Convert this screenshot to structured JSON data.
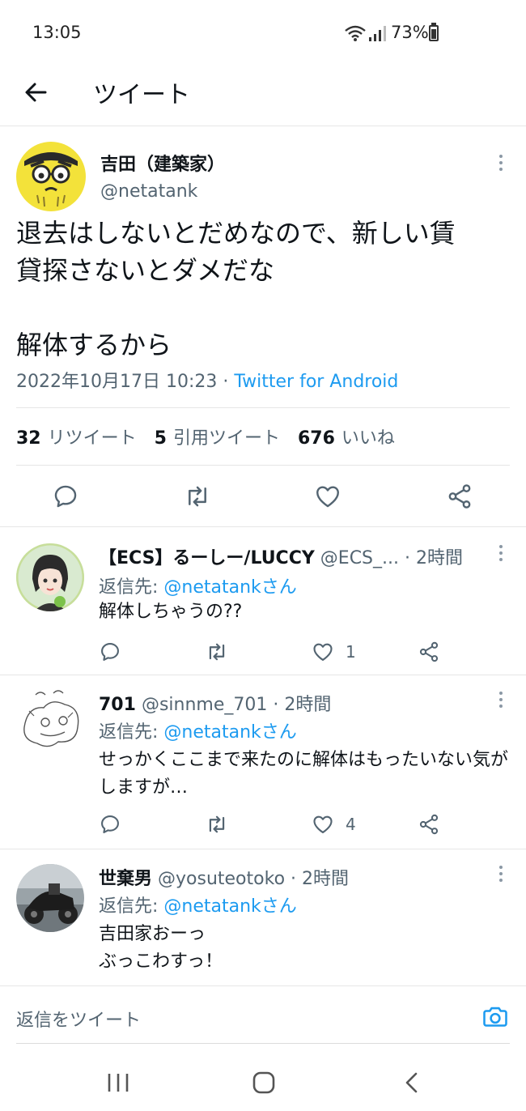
{
  "status_bar": {
    "time": "13:05",
    "battery": "73%"
  },
  "header": {
    "title": "ツイート"
  },
  "tweet": {
    "display_name": "吉田（建築家）",
    "handle": "@netatank",
    "text_lines": [
      "退去はしないとだめなので、新しい賃",
      "貸探さないとダメだな",
      "",
      "解体するから"
    ],
    "date": "2022年10月17日 10:23 · ",
    "source": "Twitter for Android",
    "stats": {
      "retweets": "32",
      "retweets_label": "リツイート",
      "quotes": "5",
      "quotes_label": "引用ツイート",
      "likes": "676",
      "likes_label": "いいね"
    }
  },
  "replies": [
    {
      "name": "【ECS】るーしー/LUCCY",
      "handle": "@ECS_...",
      "time": " · 2時間",
      "reply_to_label": "返信先: ",
      "reply_to": "@netatankさん",
      "text": "解体しちゃうの??",
      "likes": "1"
    },
    {
      "name": "701",
      "handle": "@sinnme_701",
      "time": " · 2時間",
      "reply_to_label": "返信先: ",
      "reply_to": "@netatankさん",
      "text": "せっかくここまで来たのに解体はもったいない気がしますが…",
      "likes": "4"
    },
    {
      "name": "世棄男",
      "handle": "@yosuteotoko",
      "time": " · 2時間",
      "reply_to_label": "返信先: ",
      "reply_to": "@netatankさん",
      "text_line1": "吉田家おーっ",
      "text_line2": "ぶっこわすっ！"
    }
  ],
  "compose": {
    "placeholder": "返信をツイート"
  },
  "colors": {
    "accent": "#1d9bf0",
    "text": "#0f1419",
    "muted": "#536471"
  },
  "icons": [
    "back-arrow-icon",
    "reply-icon",
    "retweet-icon",
    "like-icon",
    "share-icon",
    "camera-icon",
    "more-icon"
  ]
}
